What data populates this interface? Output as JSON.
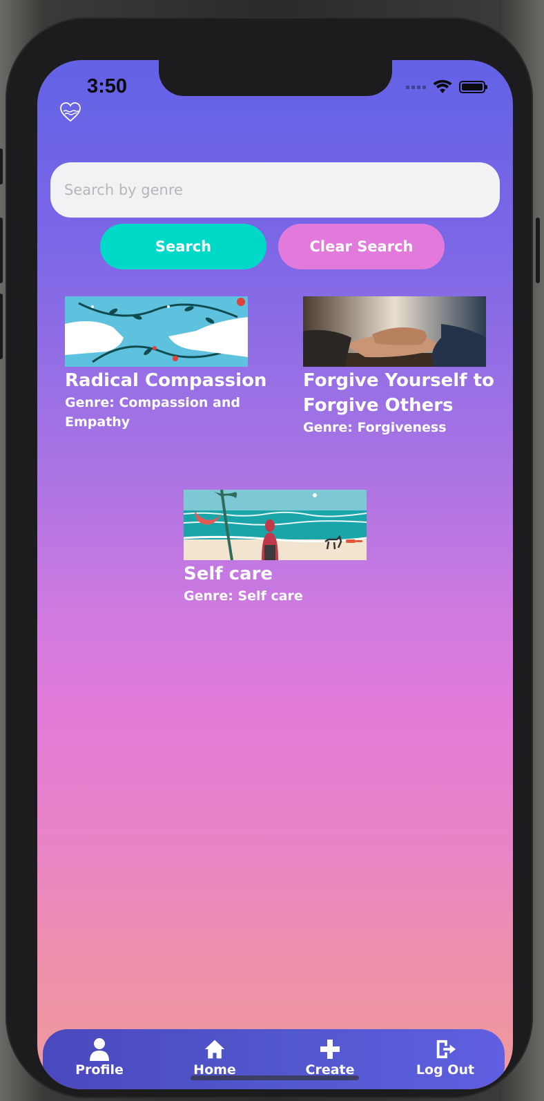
{
  "status_bar": {
    "time": "3:50"
  },
  "search": {
    "placeholder": "Search by genre",
    "value": ""
  },
  "buttons": {
    "search_label": "Search",
    "clear_label": "Clear Search"
  },
  "cards": [
    {
      "title": "Radical Compassion",
      "genre": "Genre: Compassion and Empathy",
      "image_icon": "hands-vines-illustration"
    },
    {
      "title": "Forgive Yourself to Forgive Others",
      "genre": "Genre: Forgiveness",
      "image_icon": "holding-hands-photo"
    },
    {
      "title": "Self care",
      "genre": "Genre: Self care",
      "image_icon": "beach-illustration"
    }
  ],
  "tabbar": {
    "items": [
      {
        "label": "Profile",
        "icon": "person-icon"
      },
      {
        "label": "Home",
        "icon": "home-icon"
      },
      {
        "label": "Create",
        "icon": "plus-icon"
      },
      {
        "label": "Log Out",
        "icon": "logout-icon"
      }
    ]
  },
  "colors": {
    "search_button": "#00d9c7",
    "clear_button": "#e27adb",
    "gradient_top": "#6362e6",
    "gradient_bottom": "#ee9a9c"
  }
}
